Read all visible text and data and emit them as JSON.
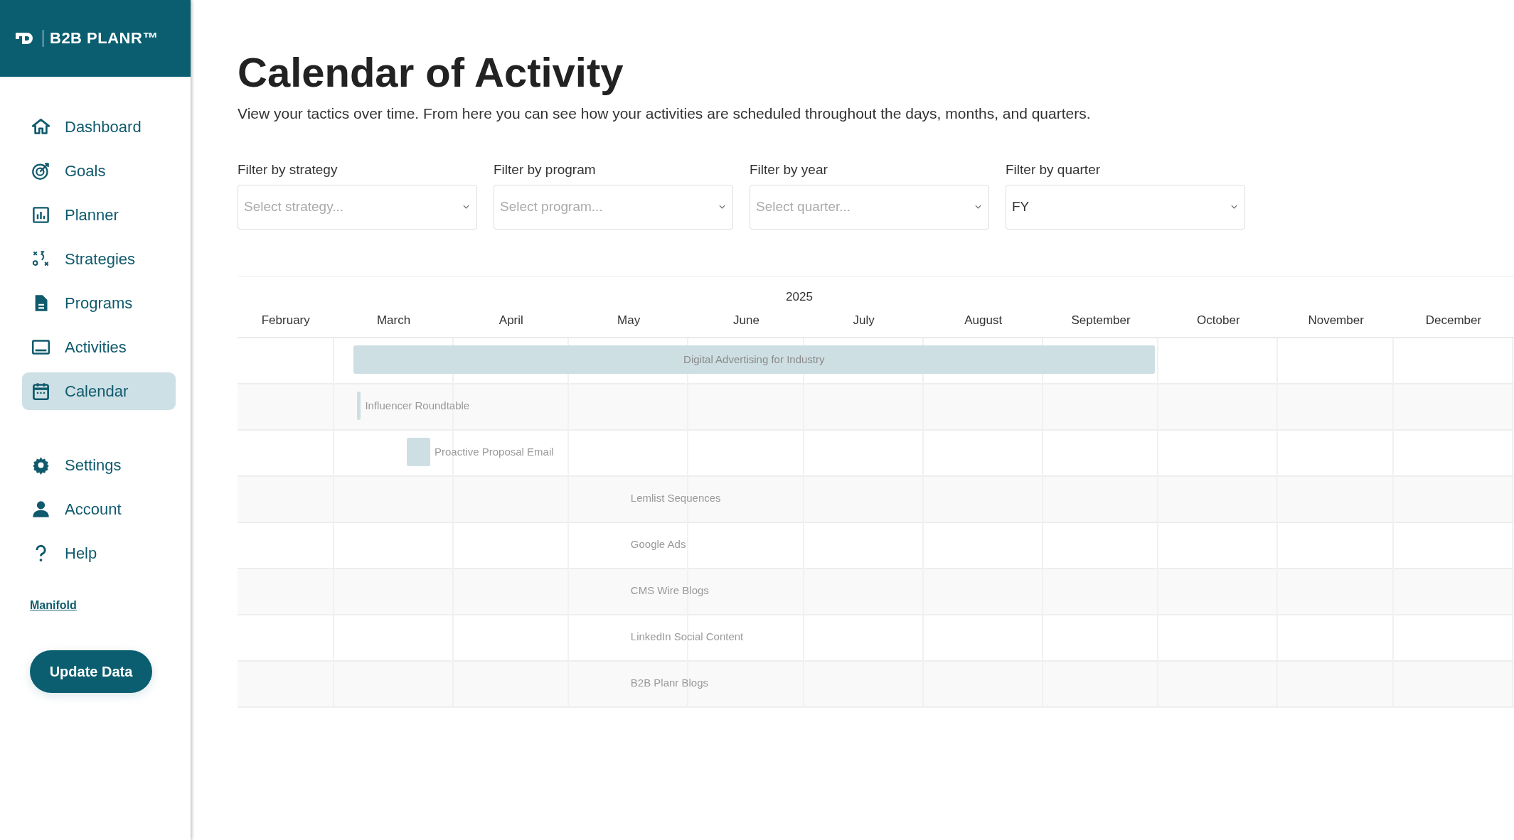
{
  "brand": {
    "name": "B2B PLANR™"
  },
  "sidebar": {
    "items": [
      {
        "label": "Dashboard",
        "selected": false
      },
      {
        "label": "Goals",
        "selected": false
      },
      {
        "label": "Planner",
        "selected": false
      },
      {
        "label": "Strategies",
        "selected": false
      },
      {
        "label": "Programs",
        "selected": false
      },
      {
        "label": "Activities",
        "selected": false
      },
      {
        "label": "Calendar",
        "selected": true
      }
    ],
    "secondary_items": [
      {
        "label": "Settings"
      },
      {
        "label": "Account"
      },
      {
        "label": "Help"
      }
    ],
    "link": "Manifold",
    "button": "Update Data"
  },
  "page": {
    "title": "Calendar of Activity",
    "subtitle": "View your tactics over time. From here you can see how your activities are scheduled throughout the days, months, and quarters."
  },
  "filters": [
    {
      "label": "Filter by strategy",
      "placeholder": "Select strategy..."
    },
    {
      "label": "Filter by program",
      "placeholder": "Select program..."
    },
    {
      "label": "Filter by year",
      "placeholder": "Select quarter..."
    },
    {
      "label": "Filter by quarter",
      "value": "FY"
    }
  ],
  "timeline": {
    "year": "2025",
    "months": [
      "February",
      "March",
      "April",
      "May",
      "June",
      "July",
      "August",
      "September",
      "October",
      "November",
      "December"
    ],
    "rows": [
      {
        "label": "Digital Advertising for Industry",
        "kind": "span"
      },
      {
        "label": "Influencer Roundtable",
        "kind": "bar"
      },
      {
        "label": "Proactive Proposal Email",
        "kind": "bar"
      },
      {
        "label": "Lemlist Sequences",
        "kind": "point"
      },
      {
        "label": "Google Ads",
        "kind": "point"
      },
      {
        "label": "CMS Wire Blogs",
        "kind": "point"
      },
      {
        "label": "LinkedIn Social Content",
        "kind": "point"
      },
      {
        "label": "B2B Planr Blogs",
        "kind": "point"
      }
    ]
  }
}
